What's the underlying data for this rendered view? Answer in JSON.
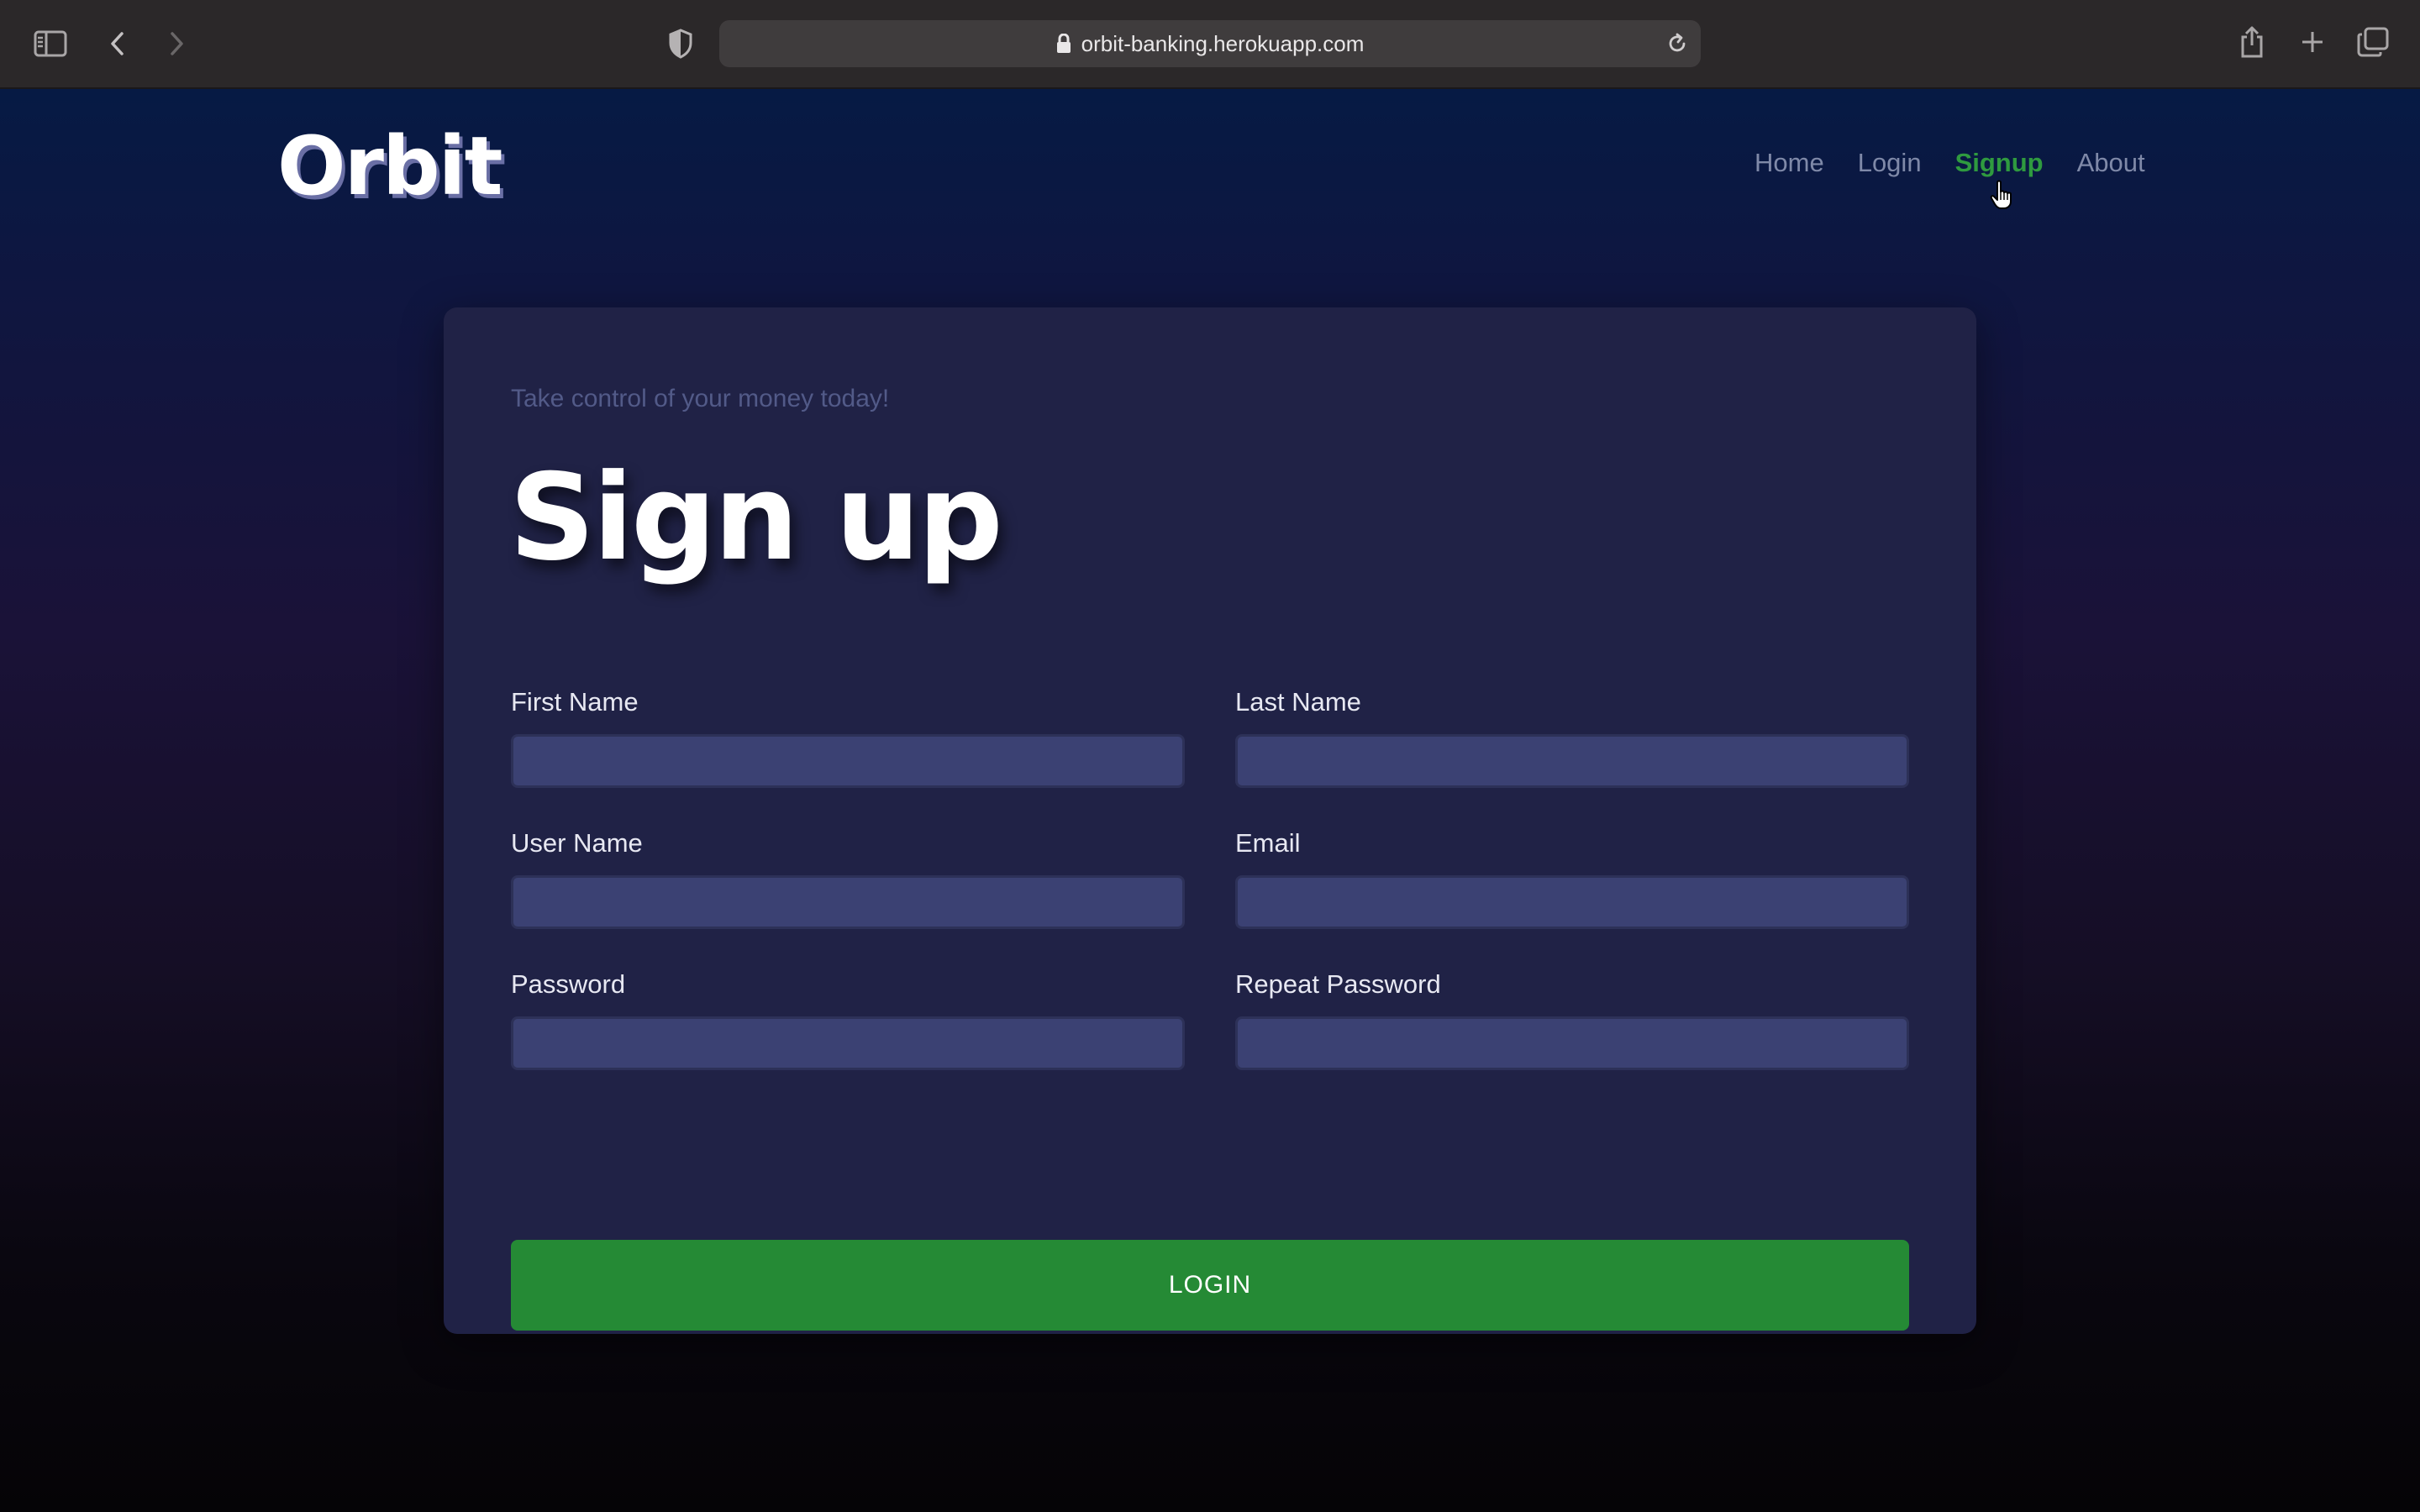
{
  "browser": {
    "url": "orbit-banking.herokuapp.com",
    "icons": [
      "sidebar-icon",
      "back-icon",
      "forward-icon",
      "privacy-shield-icon",
      "lock-icon",
      "reload-icon",
      "share-icon",
      "new-tab-icon",
      "tabs-overview-icon"
    ]
  },
  "header": {
    "logo": "Orbit",
    "nav": [
      {
        "label": "Home",
        "active": false
      },
      {
        "label": "Login",
        "active": false
      },
      {
        "label": "Signup",
        "active": true
      },
      {
        "label": "About",
        "active": false
      }
    ]
  },
  "form": {
    "tagline": "Take control of your money today!",
    "title": "Sign up",
    "fields": [
      {
        "label": "First Name",
        "value": "",
        "placeholder": ""
      },
      {
        "label": "Last Name",
        "value": "",
        "placeholder": ""
      },
      {
        "label": "User Name",
        "value": "",
        "placeholder": ""
      },
      {
        "label": "Email",
        "value": "",
        "placeholder": ""
      },
      {
        "label": "Password",
        "value": "",
        "placeholder": ""
      },
      {
        "label": "Repeat Password",
        "value": "",
        "placeholder": ""
      }
    ],
    "submit_label": "LOGIN"
  },
  "colors": {
    "accent": "#258a35",
    "nav_active": "#2f9a3f",
    "card": "#202246",
    "input": "#3b4173"
  }
}
